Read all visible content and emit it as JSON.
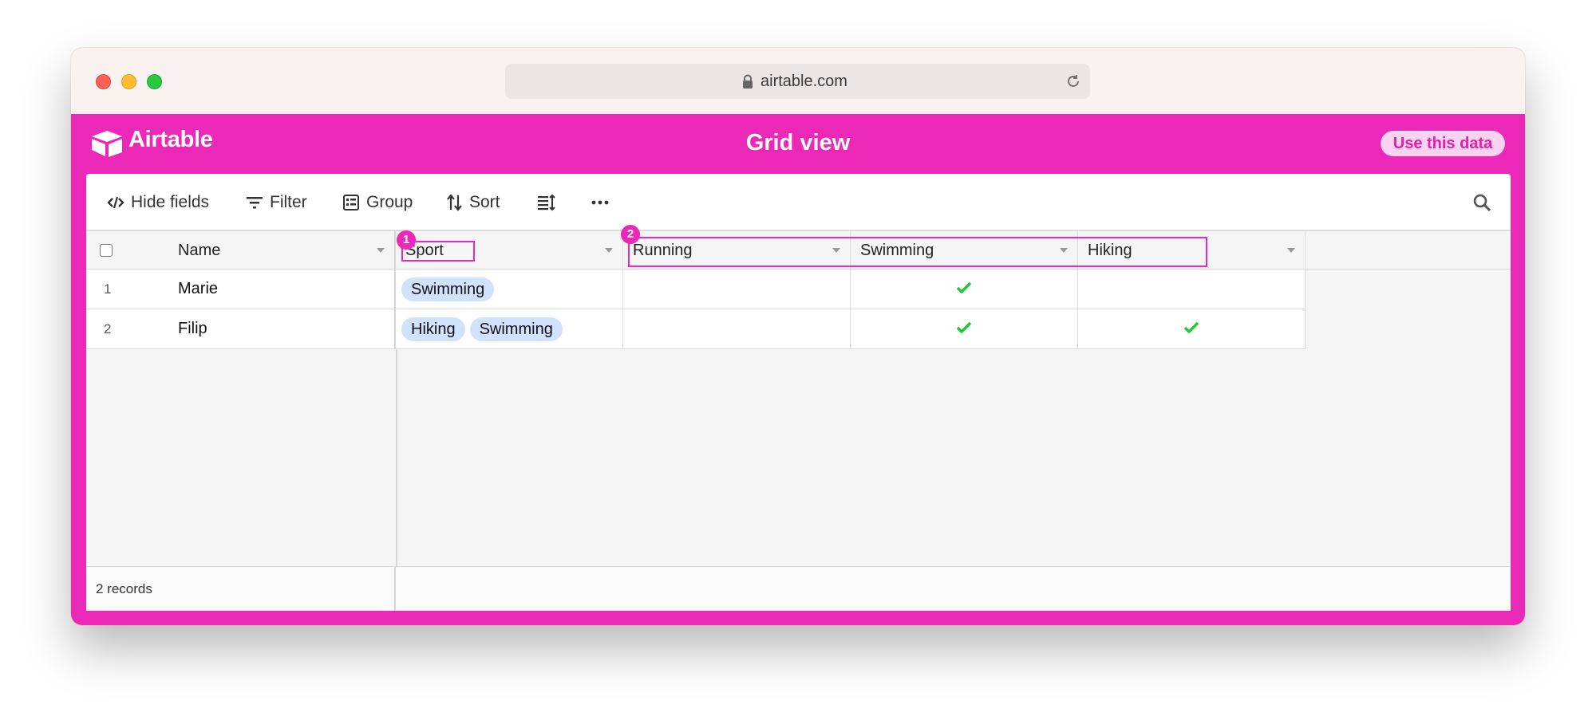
{
  "browser": {
    "url": "airtable.com"
  },
  "app": {
    "brand": "Airtable",
    "view_title": "Grid view",
    "use_data_button": "Use this data",
    "accent_color": "#ec28b9"
  },
  "toolbar": {
    "hide_fields": "Hide fields",
    "filter": "Filter",
    "group": "Group",
    "sort": "Sort",
    "row_height_icon": "row-height-icon",
    "more_icon": "ellipsis-icon",
    "search_icon": "search-icon"
  },
  "grid": {
    "columns": [
      "Name",
      "Sport",
      "Running",
      "Swimming",
      "Hiking"
    ],
    "rows": [
      {
        "num": "1",
        "name": "Marie",
        "sport": [
          "Swimming"
        ],
        "running": false,
        "swimming": true,
        "hiking": false
      },
      {
        "num": "2",
        "name": "Filip",
        "sport": [
          "Hiking",
          "Swimming"
        ],
        "running": false,
        "swimming": true,
        "hiking": true
      }
    ],
    "footer": "2 records"
  },
  "annotations": {
    "badge1": "1",
    "badge2": "2"
  }
}
